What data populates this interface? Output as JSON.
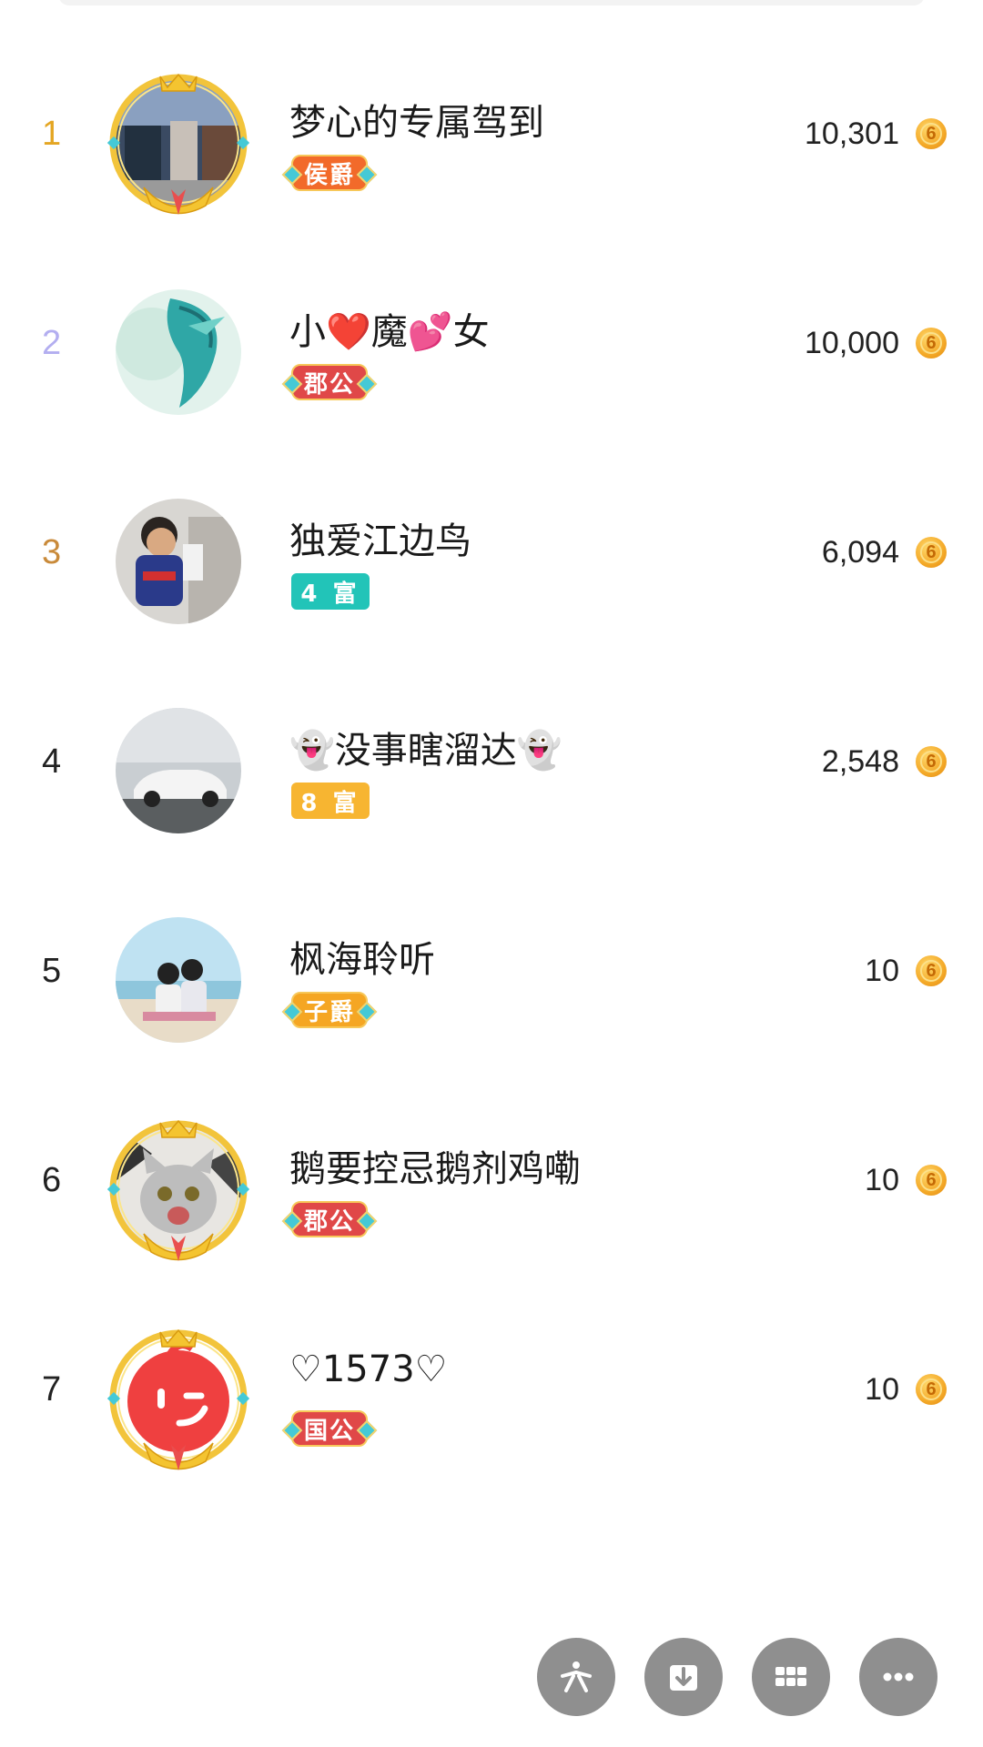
{
  "colors": {
    "rank1": "#e4a623",
    "rank2": "#b3aef0",
    "rank3": "#c98a3a",
    "rank_default": "#222222",
    "badge_houjue": "#f26a2a",
    "badge_jungong": "#e04848",
    "badge_fu_teal": "#22c4b8",
    "badge_fu_orange": "#f7b531",
    "badge_zijue": "#f5a623",
    "badge_guogong": "#e04848",
    "fab": "#8f8f8f"
  },
  "ranking": [
    {
      "rank": "1",
      "name": "梦心的专属驾到",
      "badge": "侯爵",
      "score": "10,301",
      "avatar_icon": "storefront-photo-avatar",
      "framed": true
    },
    {
      "rank": "2",
      "name": "小❤️魔💕女",
      "badge": "郡公",
      "score": "10,000",
      "avatar_icon": "dragon-avatar",
      "framed": false
    },
    {
      "rank": "3",
      "name": "独爱江边鸟",
      "badge": "4 富",
      "score": "6,094",
      "avatar_icon": "child-reading-avatar",
      "framed": false
    },
    {
      "rank": "4",
      "name": "👻没事瞎溜达👻",
      "badge": "8 富",
      "score": "2,548",
      "avatar_icon": "sports-car-avatar",
      "framed": false
    },
    {
      "rank": "5",
      "name": "枫海聆听",
      "badge": "子爵",
      "score": "10",
      "avatar_icon": "couple-beach-avatar",
      "framed": false
    },
    {
      "rank": "6",
      "name": "鹅要控忌鹅剂鸡嘞",
      "badge": "郡公",
      "score": "10",
      "avatar_icon": "cat-avatar",
      "framed": true
    },
    {
      "rank": "7",
      "name": "♡1573♡",
      "badge": "国公",
      "score": "10",
      "avatar_icon": "wink-face-avatar",
      "framed": true
    }
  ],
  "coin_glyph": "6",
  "fabs": [
    "share-icon",
    "download-icon",
    "grid-icon",
    "more-icon"
  ]
}
